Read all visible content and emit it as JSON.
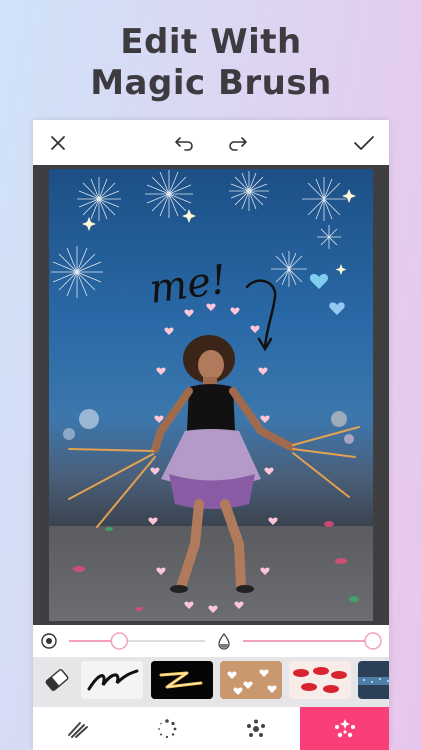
{
  "headline": {
    "line1": "Edit With",
    "line2": "Magic Brush"
  },
  "toolbar": {
    "close_icon": "close-icon",
    "undo_icon": "undo-icon",
    "redo_icon": "redo-icon",
    "confirm_icon": "checkmark-icon"
  },
  "canvas": {
    "doodle_text": "me!"
  },
  "sliders": {
    "brush_size": {
      "icon": "brush-size-icon",
      "value": 0.37
    },
    "opacity": {
      "icon": "opacity-drop-icon",
      "value": 1.0
    }
  },
  "brushes": [
    {
      "name": "eraser",
      "icon": "eraser-icon"
    },
    {
      "name": "black-pen",
      "selected": false
    },
    {
      "name": "gold-sparkle",
      "selected": true
    },
    {
      "name": "hearts",
      "selected": false
    },
    {
      "name": "lips",
      "selected": false
    },
    {
      "name": "glitter",
      "selected": false
    }
  ],
  "tabs": [
    {
      "name": "brush-strokes-tab",
      "icon": "brush-strokes-icon",
      "active": false
    },
    {
      "name": "dots-circle-tab",
      "icon": "dots-circle-icon",
      "active": false
    },
    {
      "name": "dots-cluster-tab",
      "icon": "dots-cluster-icon",
      "active": false
    },
    {
      "name": "magic-tab",
      "icon": "magic-sparkle-icon",
      "active": true
    }
  ],
  "colors": {
    "accent": "#fa3f78",
    "headline": "#3d3b40",
    "slider_track": "#f1a1bb"
  }
}
